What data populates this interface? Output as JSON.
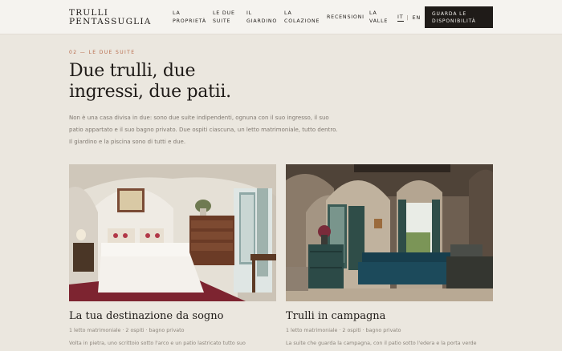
{
  "brand": {
    "line1": "TRULLI",
    "line2": "PENTASSUGLIA"
  },
  "nav": [
    {
      "label": "La\nproprietà",
      "name": "nav-la-proprieta"
    },
    {
      "label": "Le due\nsuite",
      "name": "nav-le-due-suite"
    },
    {
      "label": "Il\ngiardino",
      "name": "nav-il-giardino"
    },
    {
      "label": "La\ncolazione",
      "name": "nav-la-colazione"
    },
    {
      "label": "Recensioni",
      "name": "nav-recensioni"
    },
    {
      "label": "La\nvalle",
      "name": "nav-la-valle"
    }
  ],
  "lang": {
    "active": "IT",
    "sep": "|",
    "other": "EN"
  },
  "cta": {
    "label": "Guarda le disponibilità"
  },
  "section": {
    "eyebrow": "02 — Le due suite",
    "headline_line1": "Due trulli, due",
    "headline_line2": "ingressi, due patii.",
    "intro_line1": "Non è una casa divisa in due: sono due suite indipendenti, ognuna con il suo ingresso, il suo",
    "intro_line2": "patio appartato e il suo bagno privato. Due ospiti ciascuna, un letto matrimoniale, tutto dentro.",
    "intro_line3": "Il giardino e la piscina sono di tutti e due."
  },
  "cards": [
    {
      "title": "La tua destinazione da sogno",
      "meta": "1 letto matrimoniale · 2 ospiti · bagno privato",
      "desc": "Volta in pietra, uno scrittoio sotto l'arco e un patio lastricato tutto suo"
    },
    {
      "title": "Trulli in campagna",
      "meta": "1 letto matrimoniale · 2 ospiti · bagno privato",
      "desc": "La suite che guarda la campagna, con il patio sotto l'edera e la porta verde"
    }
  ],
  "colors": {
    "background": "#ebe7df",
    "header": "#f5f3ef",
    "accent": "#b76a4a",
    "cta_bg": "#1f1b18",
    "text_dark": "#1f1b18",
    "text_muted": "#8b847b"
  }
}
